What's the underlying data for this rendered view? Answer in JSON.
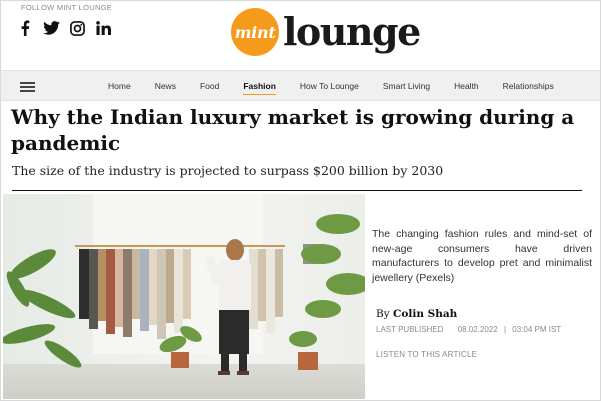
{
  "header": {
    "follow_label": "FOLLOW MINT LOUNGE",
    "social": [
      "facebook-icon",
      "twitter-icon",
      "instagram-icon",
      "linkedin-icon"
    ],
    "logo": {
      "mark": "mint",
      "word": "lounge",
      "accent": "#f49b1c"
    }
  },
  "nav": {
    "items": [
      "Home",
      "News",
      "Food",
      "Fashion",
      "How To Lounge",
      "Smart Living",
      "Health",
      "Relationships"
    ],
    "active": "Fashion"
  },
  "article": {
    "headline": "Why the Indian luxury market is growing during a pandemic",
    "subhead": "The size of the industry is projected to surpass $200 billion by 2030",
    "image_caption": "The changing fashion rules and mind-set of new-age consumers have driven manufacturers to develop pret and minimalist jewellery (Pexels)",
    "byline_prefix": "By",
    "author": "Colin Shah",
    "last_published_label": "LAST PUBLISHED",
    "date": "08.02.2022",
    "time": "03:04 PM IST",
    "listen_label": "LISTEN TO THIS ARTICLE"
  }
}
